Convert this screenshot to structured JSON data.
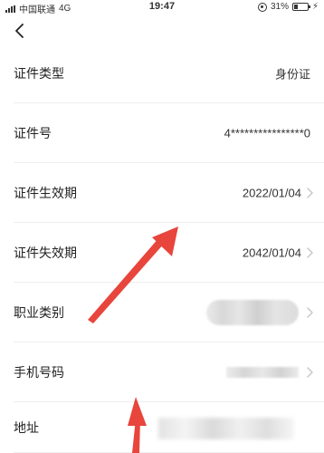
{
  "status_bar": {
    "carrier": "中国联通",
    "network": "4G",
    "time": "19:47",
    "battery": "31%",
    "battery_level": 0.31
  },
  "nav": {
    "back_icon": "chevron-left-icon"
  },
  "rows": [
    {
      "label": "证件类型",
      "value": "身份证"
    },
    {
      "label": "证件号",
      "value": "4****************0"
    },
    {
      "label": "证件生效期",
      "value": "2022/01/04"
    },
    {
      "label": "证件失效期",
      "value": "2042/01/04"
    },
    {
      "label": "职业类别",
      "value": ""
    },
    {
      "label": "手机号码",
      "value": ""
    },
    {
      "label": "地址",
      "value": ""
    }
  ],
  "annotation_color": "#e8453c",
  "chevron_color": "#c8c8c8"
}
